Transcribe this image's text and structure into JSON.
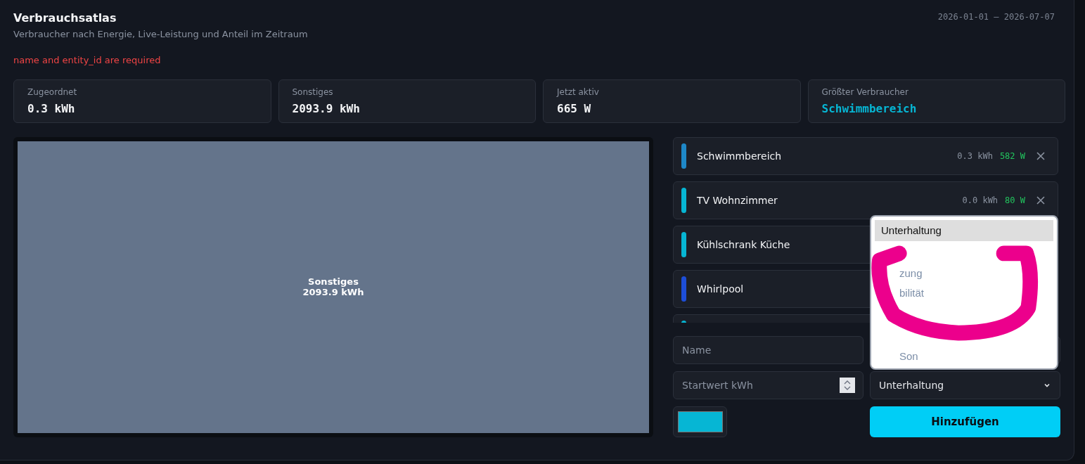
{
  "header": {
    "title": "Verbrauchsatlas",
    "subtitle": "Verbraucher nach Energie, Live-Leistung und Anteil im Zeitraum",
    "date_range": "2026-01-01 — 2026-07-07"
  },
  "error": "name and entity_id are required",
  "stats": [
    {
      "label": "Zugeordnet",
      "value": "0.3 kWh",
      "kind": "plain"
    },
    {
      "label": "Sonstiges",
      "value": "2093.9 kWh",
      "kind": "plain"
    },
    {
      "label": "Jetzt aktiv",
      "value": "665 W",
      "kind": "plain"
    },
    {
      "label": "Größter Verbraucher",
      "value": "Schwimmbereich",
      "kind": "accent"
    }
  ],
  "treemap": {
    "tiles": [
      {
        "name": "Sonstiges",
        "value": "2093.9 kWh",
        "color": "#64748b"
      }
    ]
  },
  "consumers": [
    {
      "name": "Schwimmbereich",
      "energy": "0.3 kWh",
      "power": "582 W",
      "color": "#1e88c8"
    },
    {
      "name": "TV Wohnzimmer",
      "energy": "0.0 kWh",
      "power": "80 W",
      "color": "#06b6d4"
    },
    {
      "name": "Kühlschrank Küche",
      "color": "#06b6d4"
    },
    {
      "name": "Whirlpool",
      "color": "#1d4ed8"
    },
    {
      "color": "#06b6d4"
    }
  ],
  "form": {
    "name_placeholder": "Name",
    "start_placeholder": "Startwert kWh",
    "category": "Unterhaltung",
    "color": "#06b6d4",
    "submit": "Hinzufügen"
  },
  "dropdown": {
    "options": [
      {
        "label": "Unterhaltung",
        "selected": true
      },
      {
        "label": "zung",
        "selected": false
      },
      {
        "label": "bilität",
        "selected": false
      },
      {
        "label": "Son",
        "selected": false
      }
    ]
  }
}
